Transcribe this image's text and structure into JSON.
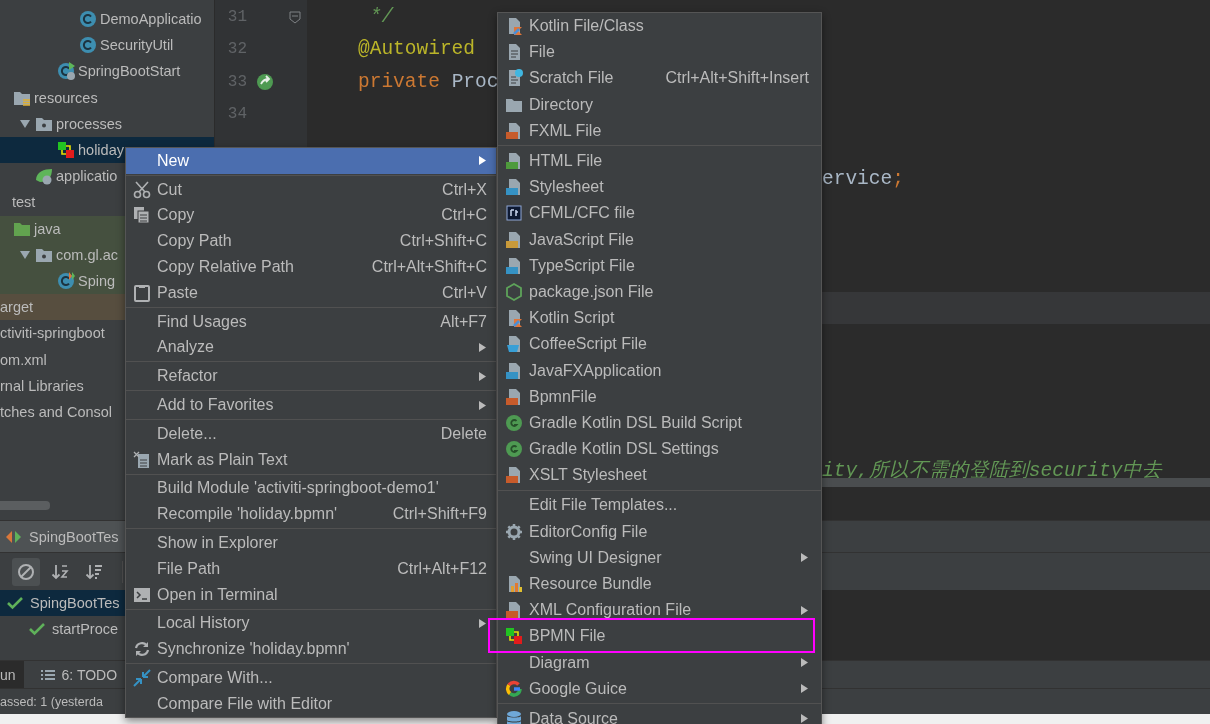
{
  "tree": {
    "items": [
      {
        "children": [
          {
            "children": [
              {
                "children": [
                  {
                    "children": [
                      {
                        "children": [
                          {
                            "children": [
                              {
                                "label": "DemoApplicatio",
                                "kind": "class",
                                "selected": false,
                                "test_scope": false,
                                "excluded": false
                              },
                              {
                                "label": "SecurityUtil",
                                "kind": "class",
                                "selected": false,
                                "test_scope": false,
                                "excluded": false
                              }
                            ]
                          },
                          {
                            "label": "SpringBootStart",
                            "kind": "spring_main",
                            "selected": false,
                            "test_scope": false,
                            "excluded": false
                          }
                        ]
                      }
                    ]
                  },
                  {
                    "label": "resources",
                    "kind": "resources_folder",
                    "selected": false,
                    "test_scope": false,
                    "excluded": false,
                    "children": [
                      {
                        "label": "processes",
                        "kind": "package",
                        "selected": false,
                        "expanded": true,
                        "test_scope": false,
                        "excluded": false,
                        "children": [
                          {
                            "label": "holiday",
                            "kind": "bpmn",
                            "selected": true
                          }
                        ]
                      },
                      {
                        "label": "applicatio",
                        "kind": "spring_config",
                        "selected": false,
                        "test_scope": false,
                        "excluded": false
                      }
                    ]
                  }
                ]
              },
              {
                "label": "test",
                "selected": false,
                "test_scope": false,
                "excluded": false,
                "children": [
                  {
                    "label": "java",
                    "kind": "test_source_folder",
                    "selected": false,
                    "test_scope": true,
                    "excluded": false,
                    "children": [
                      {
                        "label": "com.gl.ac",
                        "kind": "package",
                        "selected": false,
                        "expanded": true,
                        "test_scope": true,
                        "excluded": false,
                        "children": [
                          {
                            "label": "Sping",
                            "kind": "test_class",
                            "selected": false,
                            "test_scope": true,
                            "excluded": false
                          }
                        ]
                      }
                    ]
                  }
                ]
              }
            ]
          },
          {
            "label": "arget",
            "selected": false,
            "test_scope": false,
            "excluded": true
          },
          {
            "label": "ctiviti-springboot",
            "selected": false,
            "test_scope": false,
            "excluded": false
          },
          {
            "label": "om.xml",
            "selected": false,
            "test_scope": false,
            "excluded": false
          }
        ]
      },
      {
        "label": "rnal Libraries",
        "selected": false,
        "test_scope": false,
        "excluded": false
      },
      {
        "label": "tches and Consol",
        "selected": false,
        "test_scope": false,
        "excluded": false
      }
    ]
  },
  "editor": {
    "lines": [
      {
        "number": "31",
        "code": [
          {
            "text": " */",
            "kind": "comment"
          }
        ],
        "current": false
      },
      {
        "number": "32",
        "code": [
          {
            "text": "@Autowired",
            "kind": "annotation"
          }
        ],
        "current": false
      },
      {
        "number": "33",
        "code": [
          {
            "text": "private ",
            "kind": "keyword"
          },
          {
            "text": "Proc",
            "kind": "plain"
          }
        ],
        "current": false
      },
      {
        "number": "34",
        "current": false
      },
      {
        "current": false
      },
      {
        "tail": [
          {
            "text": "ervice",
            "kind": "plain"
          },
          {
            "text": ";",
            "kind": "keyword"
          }
        ],
        "current": false
      },
      {
        "current": false
      },
      {
        "current": false
      },
      {
        "current": false
      },
      {
        "current": true
      },
      {
        "current": false
      },
      {
        "current": false
      },
      {
        "current": false
      },
      {
        "current": false
      },
      {
        "tail": [
          {
            "text": "ity,所以不需的登陆到security中去",
            "kind": "comment"
          }
        ],
        "current": false
      }
    ]
  },
  "run_panel": {
    "tab": {
      "label": "SpingBootTes"
    },
    "toolbar": [
      {
        "on": true
      },
      {
        "on": false
      },
      {
        "on": false
      }
    ],
    "tests": [
      {
        "label": "SpingBootTes",
        "passed": true,
        "selected": true,
        "children": [
          {
            "label": "startProce",
            "passed": true,
            "selected": false
          }
        ]
      }
    ],
    "tool_tabs": [
      {
        "label": "un",
        "selected": true
      },
      {
        "label": "6: TODO",
        "selected": false
      }
    ],
    "status_bar": {
      "text": "assed: 1 (yesterda"
    }
  },
  "context_menu": {
    "items": [
      {
        "kind": "item",
        "label": "New",
        "selected": true,
        "submenu": true
      },
      {
        "kind": "separator"
      },
      {
        "kind": "item",
        "label": "Cut",
        "shortcut": "Ctrl+X",
        "selected": false
      },
      {
        "kind": "item",
        "label": "Copy",
        "shortcut": "Ctrl+C",
        "selected": false
      },
      {
        "kind": "item",
        "label": "Copy Path",
        "shortcut": "Ctrl+Shift+C",
        "selected": false
      },
      {
        "kind": "item",
        "label": "Copy Relative Path",
        "shortcut": "Ctrl+Alt+Shift+C",
        "selected": false
      },
      {
        "kind": "item",
        "label": "Paste",
        "shortcut": "Ctrl+V",
        "selected": false
      },
      {
        "kind": "separator"
      },
      {
        "kind": "item",
        "label": "Find Usages",
        "shortcut": "Alt+F7",
        "selected": false
      },
      {
        "kind": "item",
        "label": "Analyze",
        "selected": false,
        "submenu": true
      },
      {
        "kind": "separator"
      },
      {
        "kind": "item",
        "label": "Refactor",
        "selected": false,
        "submenu": true
      },
      {
        "kind": "separator"
      },
      {
        "kind": "item",
        "label": "Add to Favorites",
        "selected": false,
        "submenu": true
      },
      {
        "kind": "separator"
      },
      {
        "kind": "item",
        "label": "Delete...",
        "shortcut": "Delete",
        "selected": false
      },
      {
        "kind": "item",
        "label": "Mark as Plain Text",
        "selected": false
      },
      {
        "kind": "separator"
      },
      {
        "kind": "item",
        "label": "Build Module 'activiti-springboot-demo1'",
        "selected": false
      },
      {
        "kind": "item",
        "label": "Recompile 'holiday.bpmn'",
        "shortcut": "Ctrl+Shift+F9",
        "selected": false
      },
      {
        "kind": "separator"
      },
      {
        "kind": "item",
        "label": "Show in Explorer",
        "selected": false
      },
      {
        "kind": "item",
        "label": "File Path",
        "shortcut": "Ctrl+Alt+F12",
        "selected": false
      },
      {
        "kind": "item",
        "label": "Open in Terminal",
        "selected": false
      },
      {
        "kind": "separator"
      },
      {
        "kind": "item",
        "label": "Local History",
        "selected": false,
        "submenu": true
      },
      {
        "kind": "item",
        "label": "Synchronize 'holiday.bpmn'",
        "selected": false
      },
      {
        "kind": "separator"
      },
      {
        "kind": "item",
        "label": "Compare With...",
        "selected": false
      },
      {
        "kind": "item",
        "label": "Compare File with Editor",
        "selected": false
      }
    ]
  },
  "new_menu": {
    "items": [
      {
        "kind": "item",
        "label": "Kotlin File/Class",
        "selected": false
      },
      {
        "kind": "item",
        "label": "File",
        "selected": false
      },
      {
        "kind": "item",
        "label": "Scratch File",
        "shortcut": "Ctrl+Alt+Shift+Insert",
        "selected": false
      },
      {
        "kind": "item",
        "label": "Directory",
        "selected": false
      },
      {
        "kind": "item",
        "label": "FXML File",
        "selected": false
      },
      {
        "kind": "separator"
      },
      {
        "kind": "item",
        "label": "HTML File",
        "selected": false
      },
      {
        "kind": "item",
        "label": "Stylesheet",
        "selected": false
      },
      {
        "kind": "item",
        "label": "CFML/CFC file",
        "selected": false
      },
      {
        "kind": "item",
        "label": "JavaScript File",
        "selected": false
      },
      {
        "kind": "item",
        "label": "TypeScript File",
        "selected": false
      },
      {
        "kind": "item",
        "label": "package.json File",
        "selected": false
      },
      {
        "kind": "item",
        "label": "Kotlin Script",
        "selected": false
      },
      {
        "kind": "item",
        "label": "CoffeeScript File",
        "selected": false
      },
      {
        "kind": "item",
        "label": "JavaFXApplication",
        "selected": false
      },
      {
        "kind": "item",
        "label": "BpmnFile",
        "selected": false
      },
      {
        "kind": "item",
        "label": "Gradle Kotlin DSL Build Script",
        "selected": false
      },
      {
        "kind": "item",
        "label": "Gradle Kotlin DSL Settings",
        "selected": false
      },
      {
        "kind": "item",
        "label": "XSLT Stylesheet",
        "selected": false
      },
      {
        "kind": "separator"
      },
      {
        "kind": "item",
        "label": "Edit File Templates...",
        "selected": false
      },
      {
        "kind": "item",
        "label": "EditorConfig File",
        "selected": false
      },
      {
        "kind": "item",
        "label": "Swing UI Designer",
        "selected": false,
        "submenu": true
      },
      {
        "kind": "item",
        "label": "Resource Bundle",
        "selected": false
      },
      {
        "kind": "item",
        "label": "XML Configuration File",
        "selected": false,
        "submenu": true
      },
      {
        "kind": "item",
        "label": "BPMN File",
        "selected": false,
        "highlighted": true
      },
      {
        "kind": "item",
        "label": "Diagram",
        "selected": false,
        "submenu": true
      },
      {
        "kind": "item",
        "label": "Google Guice",
        "selected": false,
        "submenu": true
      },
      {
        "kind": "separator"
      },
      {
        "kind": "item",
        "label": "Data Source",
        "selected": false,
        "submenu": true
      }
    ]
  }
}
